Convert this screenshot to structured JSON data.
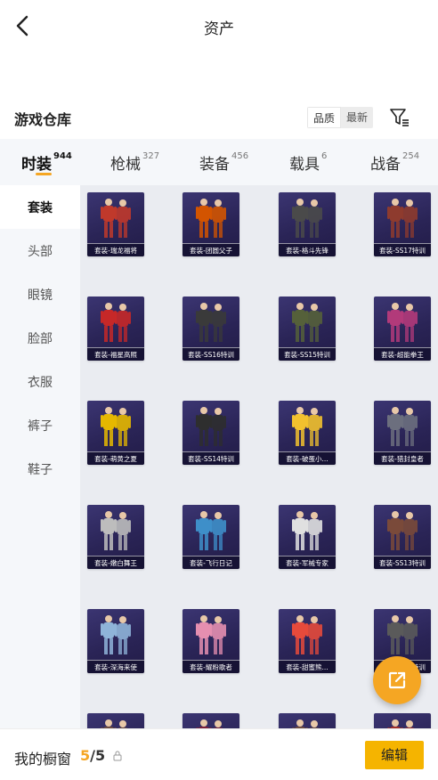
{
  "header": {
    "title": "资产"
  },
  "warehouse": {
    "title": "游戏仓库",
    "sort_options": [
      "品质",
      "最新"
    ]
  },
  "tabs": [
    {
      "label": "时装",
      "count": "944"
    },
    {
      "label": "枪械",
      "count": "327"
    },
    {
      "label": "装备",
      "count": "456"
    },
    {
      "label": "载具",
      "count": "6"
    },
    {
      "label": "战备",
      "count": "254"
    }
  ],
  "sidebar": [
    "套装",
    "头部",
    "眼镜",
    "脸部",
    "衣服",
    "裤子",
    "鞋子"
  ],
  "items": [
    {
      "caption": "套装-瑞龙福将",
      "color": "#c0392b"
    },
    {
      "caption": "套装-团圆父子",
      "color": "#d35400"
    },
    {
      "caption": "套装-格斗先锋",
      "color": "#4a4a4a"
    },
    {
      "caption": "套装-SS17特训",
      "color": "#8e3b2e"
    },
    {
      "caption": "套装-福星高照",
      "color": "#c62828"
    },
    {
      "caption": "套装-SS16特训",
      "color": "#3a3a3a"
    },
    {
      "caption": "套装-SS15特训",
      "color": "#55603a"
    },
    {
      "caption": "套装-超能拳王",
      "color": "#b23a7a"
    },
    {
      "caption": "套装-萌黄之夏",
      "color": "#e6b800"
    },
    {
      "caption": "套装-SS14特训",
      "color": "#2e2e2e"
    },
    {
      "caption": "套装-破蛋小...",
      "color": "#f2c12e"
    },
    {
      "caption": "套装-猎封皇者",
      "color": "#6c6f7e"
    },
    {
      "caption": "套装-嫩白舞王",
      "color": "#bdbdbd"
    },
    {
      "caption": "套装-飞行日记",
      "color": "#3e8fc9"
    },
    {
      "caption": "套装-军械专家",
      "color": "#e0e0e0"
    },
    {
      "caption": "套装-SS13特训",
      "color": "#7a4a3a"
    },
    {
      "caption": "套装-深海来使",
      "color": "#8fb4d9"
    },
    {
      "caption": "套装-耀粉歌者",
      "color": "#e68fb0"
    },
    {
      "caption": "套装-甜蜜熊...",
      "color": "#e64a3b"
    },
    {
      "caption": "套装-SS12特训",
      "color": "#5a5a5a"
    },
    {
      "caption": "",
      "color": "#6d4c41"
    },
    {
      "caption": "",
      "color": "#7b1f3a"
    },
    {
      "caption": "",
      "color": "#6d4c41"
    },
    {
      "caption": "",
      "color": "#a1302a"
    }
  ],
  "bottom": {
    "label": "我的橱窗",
    "current": "5",
    "separator": "/",
    "max": "5",
    "edit_label": "编辑"
  },
  "icons": {
    "back": "back-arrow-icon",
    "filter": "filter-icon",
    "share": "external-link-icon",
    "lock": "lock-icon"
  },
  "colors": {
    "accent": "#f5a623",
    "button": "#f5b400",
    "card": "#2a2456"
  }
}
